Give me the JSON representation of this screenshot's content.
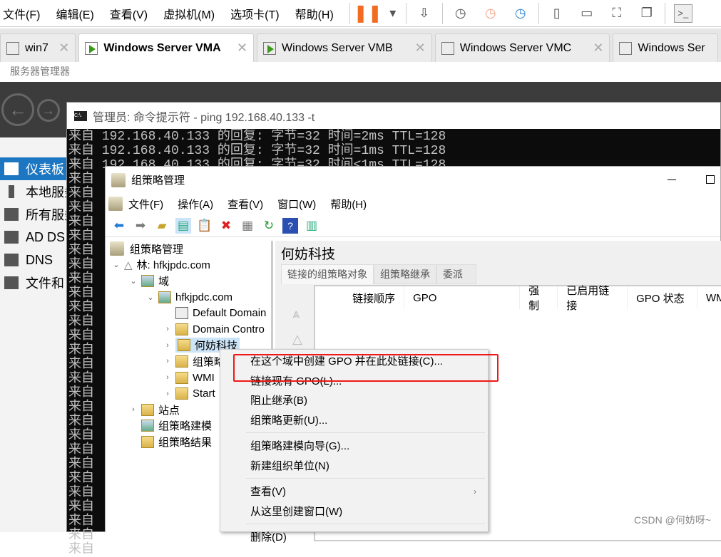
{
  "vmware": {
    "menu": [
      "文件(F)",
      "编辑(E)",
      "查看(V)",
      "虚拟机(M)",
      "选项卡(T)",
      "帮助(H)"
    ],
    "tabs": [
      {
        "label": "win7",
        "running": false
      },
      {
        "label": "Windows Server VMA",
        "running": true,
        "active": true
      },
      {
        "label": "Windows Server VMB",
        "running": true
      },
      {
        "label": "Windows Server VMC",
        "running": false
      },
      {
        "label": "Windows Ser",
        "running": false
      }
    ],
    "accent": "#f26b21"
  },
  "server_manager": {
    "label": "服务器管理器",
    "sidebar": [
      "仪表板",
      "本地服务",
      "所有服务",
      "AD DS",
      "DNS",
      "文件和"
    ]
  },
  "cmd": {
    "title": "管理员: 命令提示符 - ping  192.168.40.133 -t",
    "lines": [
      "来自 192.168.40.133 的回复: 字节=32 时间=2ms TTL=128",
      "来自 192.168.40.133 的回复: 字节=32 时间=1ms TTL=128",
      "来自 192.168.40.133 的回复: 字节=32 时间<1ms TTL=128"
    ],
    "prefix": "来自"
  },
  "gpm": {
    "title": "组策略管理",
    "menu": [
      "文件(F)",
      "操作(A)",
      "查看(V)",
      "窗口(W)",
      "帮助(H)"
    ],
    "tree": {
      "root": "组策略管理",
      "forest": "林: hfkjpdc.com",
      "domains": "域",
      "domain": "hfkjpdc.com",
      "children": [
        "Default Domain",
        "Domain Contro",
        "何妨科技",
        "组策略",
        "WMI",
        "Start"
      ],
      "sites": "站点",
      "modeling": "组策略建模",
      "results": "组策略结果"
    },
    "right": {
      "title": "何妨科技",
      "tabs": [
        "链接的组策略对象",
        "组策略继承",
        "委派"
      ],
      "columns": [
        "链接顺序",
        "GPO",
        "强制",
        "已启用链接",
        "GPO 状态",
        "WM"
      ]
    }
  },
  "context_menu": {
    "items": [
      "在这个域中创建 GPO 并在此处链接(C)...",
      "链接现有 GPO(L)...",
      "阻止继承(B)",
      "组策略更新(U)..."
    ],
    "items2": [
      "组策略建模向导(G)...",
      "新建组织单位(N)"
    ],
    "items3": [
      "查看(V)",
      "从这里创建窗口(W)"
    ],
    "items4": [
      "删除(D)"
    ],
    "highlight_color": "#f01818"
  },
  "watermark": "CSDN @何妨呀~"
}
